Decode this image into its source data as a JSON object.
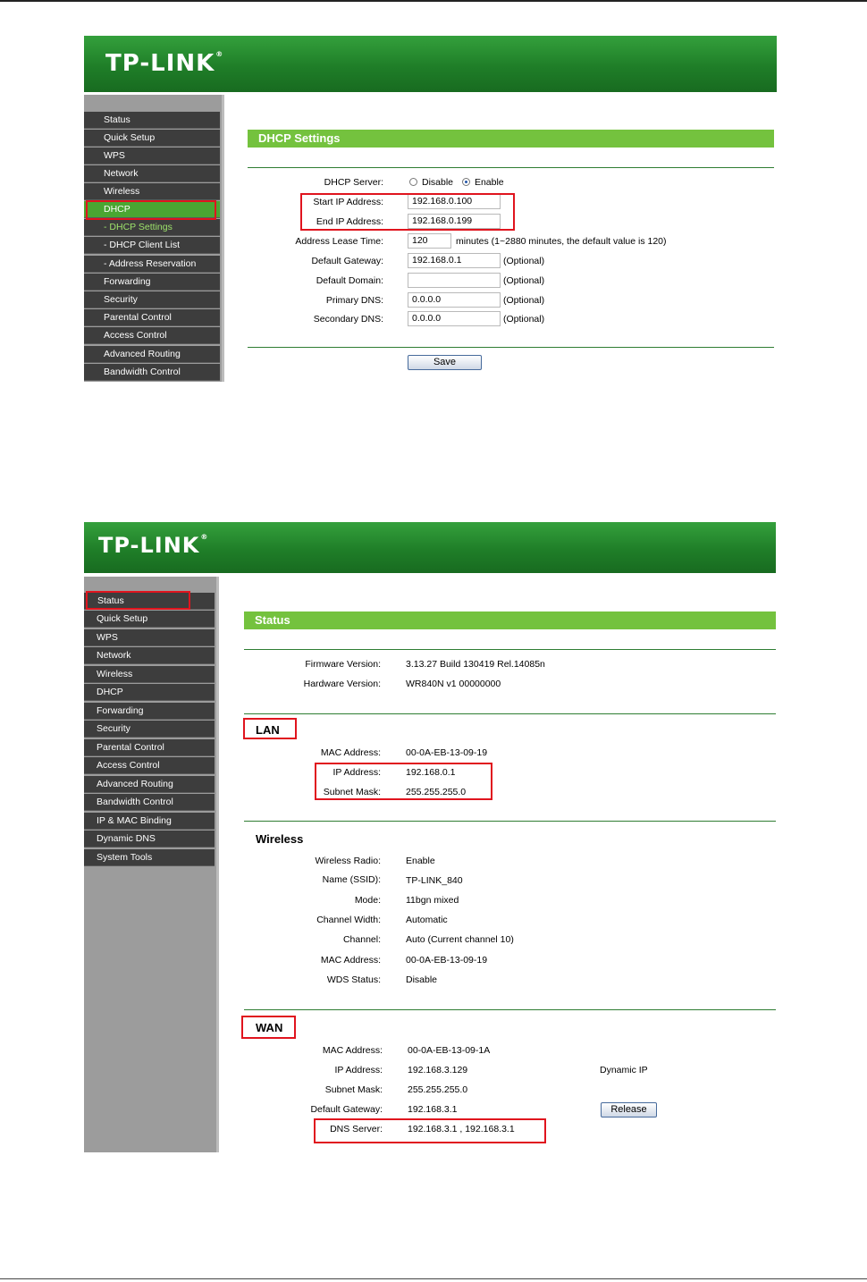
{
  "brand": "TP-LINK",
  "shot1": {
    "nav": [
      {
        "label": "Status"
      },
      {
        "label": "Quick Setup"
      },
      {
        "label": "WPS"
      },
      {
        "label": "Network"
      },
      {
        "label": "Wireless"
      },
      {
        "label": "DHCP"
      },
      {
        "label": "- DHCP Settings"
      },
      {
        "label": "- DHCP Client List"
      },
      {
        "label": "- Address Reservation"
      },
      {
        "label": "Forwarding"
      },
      {
        "label": "Security"
      },
      {
        "label": "Parental Control"
      },
      {
        "label": "Access Control"
      },
      {
        "label": "Advanced Routing"
      },
      {
        "label": "Bandwidth Control"
      }
    ],
    "title": "DHCP Settings",
    "dhcp_server_label": "DHCP Server:",
    "disable_label": "Disable",
    "enable_label": "Enable",
    "start_ip_label": "Start IP Address:",
    "start_ip": "192.168.0.100",
    "end_ip_label": "End IP Address:",
    "end_ip": "192.168.0.199",
    "lease_label": "Address Lease Time:",
    "lease": "120",
    "lease_note": "minutes (1~2880 minutes, the default value is 120)",
    "gateway_label": "Default Gateway:",
    "gateway": "192.168.0.1",
    "domain_label": "Default Domain:",
    "domain": "",
    "primary_dns_label": "Primary DNS:",
    "primary_dns": "0.0.0.0",
    "secondary_dns_label": "Secondary DNS:",
    "secondary_dns": "0.0.0.0",
    "optional": "(Optional)",
    "save_label": "Save"
  },
  "shot2": {
    "nav": [
      {
        "label": "Status"
      },
      {
        "label": "Quick Setup"
      },
      {
        "label": "WPS"
      },
      {
        "label": "Network"
      },
      {
        "label": "Wireless"
      },
      {
        "label": "DHCP"
      },
      {
        "label": "Forwarding"
      },
      {
        "label": "Security"
      },
      {
        "label": "Parental Control"
      },
      {
        "label": "Access Control"
      },
      {
        "label": "Advanced Routing"
      },
      {
        "label": "Bandwidth Control"
      },
      {
        "label": "IP & MAC Binding"
      },
      {
        "label": "Dynamic DNS"
      },
      {
        "label": "System Tools"
      }
    ],
    "title": "Status",
    "firmware_label": "Firmware Version:",
    "firmware": "3.13.27 Build 130419 Rel.14085n",
    "hardware_label": "Hardware Version:",
    "hardware": "WR840N v1 00000000",
    "lan": {
      "heading": "LAN",
      "mac_label": "MAC Address:",
      "mac": "00-0A-EB-13-09-19",
      "ip_label": "IP Address:",
      "ip": "192.168.0.1",
      "mask_label": "Subnet Mask:",
      "mask": "255.255.255.0"
    },
    "wireless": {
      "heading": "Wireless",
      "radio_label": "Wireless Radio:",
      "radio": "Enable",
      "ssid_label": "Name (SSID):",
      "ssid": "TP-LINK_840",
      "mode_label": "Mode:",
      "mode": "11bgn mixed",
      "width_label": "Channel Width:",
      "width": "Automatic",
      "channel_label": "Channel:",
      "channel": "Auto (Current channel 10)",
      "mac_label": "MAC Address:",
      "mac": "00-0A-EB-13-09-19",
      "wds_label": "WDS Status:",
      "wds": "Disable"
    },
    "wan": {
      "heading": "WAN",
      "mac_label": "MAC Address:",
      "mac": "00-0A-EB-13-09-1A",
      "ip_label": "IP Address:",
      "ip": "192.168.3.129",
      "conn_type": "Dynamic IP",
      "mask_label": "Subnet Mask:",
      "mask": "255.255.255.0",
      "gateway_label": "Default Gateway:",
      "gateway": "192.168.3.1",
      "release_label": "Release",
      "dns_label": "DNS Server:",
      "dns": "192.168.3.1 , 192.168.3.1"
    }
  }
}
